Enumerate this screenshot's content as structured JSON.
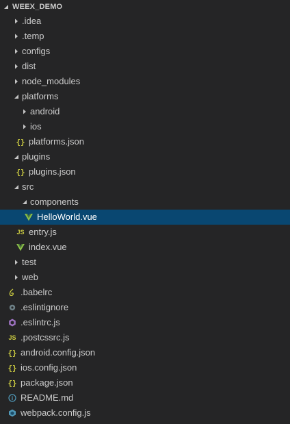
{
  "explorer": {
    "title": "WEEX_DEMO"
  },
  "tree": [
    {
      "label": ".idea",
      "type": "folder",
      "expanded": false,
      "depth": 1,
      "name": "folder-idea"
    },
    {
      "label": ".temp",
      "type": "folder",
      "expanded": false,
      "depth": 1,
      "name": "folder-temp"
    },
    {
      "label": "configs",
      "type": "folder",
      "expanded": false,
      "depth": 1,
      "name": "folder-configs"
    },
    {
      "label": "dist",
      "type": "folder",
      "expanded": false,
      "depth": 1,
      "name": "folder-dist"
    },
    {
      "label": "node_modules",
      "type": "folder",
      "expanded": false,
      "depth": 1,
      "name": "folder-node-modules"
    },
    {
      "label": "platforms",
      "type": "folder",
      "expanded": true,
      "depth": 1,
      "name": "folder-platforms"
    },
    {
      "label": "android",
      "type": "folder",
      "expanded": false,
      "depth": 2,
      "name": "folder-android"
    },
    {
      "label": "ios",
      "type": "folder",
      "expanded": false,
      "depth": 2,
      "name": "folder-ios"
    },
    {
      "label": "platforms.json",
      "type": "json",
      "depth": 2,
      "name": "file-platforms-json"
    },
    {
      "label": "plugins",
      "type": "folder",
      "expanded": true,
      "depth": 1,
      "name": "folder-plugins"
    },
    {
      "label": "plugins.json",
      "type": "json",
      "depth": 2,
      "name": "file-plugins-json"
    },
    {
      "label": "src",
      "type": "folder",
      "expanded": true,
      "depth": 1,
      "name": "folder-src"
    },
    {
      "label": "components",
      "type": "folder",
      "expanded": true,
      "depth": 2,
      "name": "folder-components"
    },
    {
      "label": "HelloWorld.vue",
      "type": "vue",
      "depth": 3,
      "selected": true,
      "name": "file-helloworld-vue"
    },
    {
      "label": "entry.js",
      "type": "js",
      "depth": 2,
      "name": "file-entry-js"
    },
    {
      "label": "index.vue",
      "type": "vue",
      "depth": 2,
      "name": "file-index-vue"
    },
    {
      "label": "test",
      "type": "folder",
      "expanded": false,
      "depth": 1,
      "name": "folder-test"
    },
    {
      "label": "web",
      "type": "folder",
      "expanded": false,
      "depth": 1,
      "name": "folder-web"
    },
    {
      "label": ".babelrc",
      "type": "babel",
      "depth": 1,
      "name": "file-babelrc"
    },
    {
      "label": ".eslintignore",
      "type": "gear",
      "depth": 1,
      "name": "file-eslintignore"
    },
    {
      "label": ".eslintrc.js",
      "type": "eslint",
      "depth": 1,
      "name": "file-eslintrc-js"
    },
    {
      "label": ".postcssrc.js",
      "type": "js",
      "depth": 1,
      "name": "file-postcssrc-js"
    },
    {
      "label": "android.config.json",
      "type": "json",
      "depth": 1,
      "name": "file-android-config-json"
    },
    {
      "label": "ios.config.json",
      "type": "json",
      "depth": 1,
      "name": "file-ios-config-json"
    },
    {
      "label": "package.json",
      "type": "json",
      "depth": 1,
      "name": "file-package-json"
    },
    {
      "label": "README.md",
      "type": "info",
      "depth": 1,
      "name": "file-readme-md"
    },
    {
      "label": "webpack.config.js",
      "type": "webpack",
      "depth": 1,
      "name": "file-webpack-config-js"
    }
  ],
  "icons": {
    "folder-collapsed": "chevron-right-icon",
    "folder-expanded": "chevron-down-icon",
    "json": "json-braces-icon",
    "vue": "vue-logo-icon",
    "js": "js-icon",
    "babel": "babel-icon",
    "gear": "gear-icon",
    "eslint": "eslint-icon",
    "info": "info-icon",
    "webpack": "webpack-cube-icon"
  },
  "colors": {
    "background": "#252526",
    "selected": "#094771",
    "text": "#cccccc",
    "selected_text": "#ffffff",
    "json_icon": "#cbcb41",
    "vue_icon": "#8dc149",
    "babel_icon": "#cbcb41",
    "gear_icon": "#6d8086",
    "eslint_icon": "#a074c4",
    "info_icon": "#519aba",
    "webpack_icon": "#519aba"
  }
}
